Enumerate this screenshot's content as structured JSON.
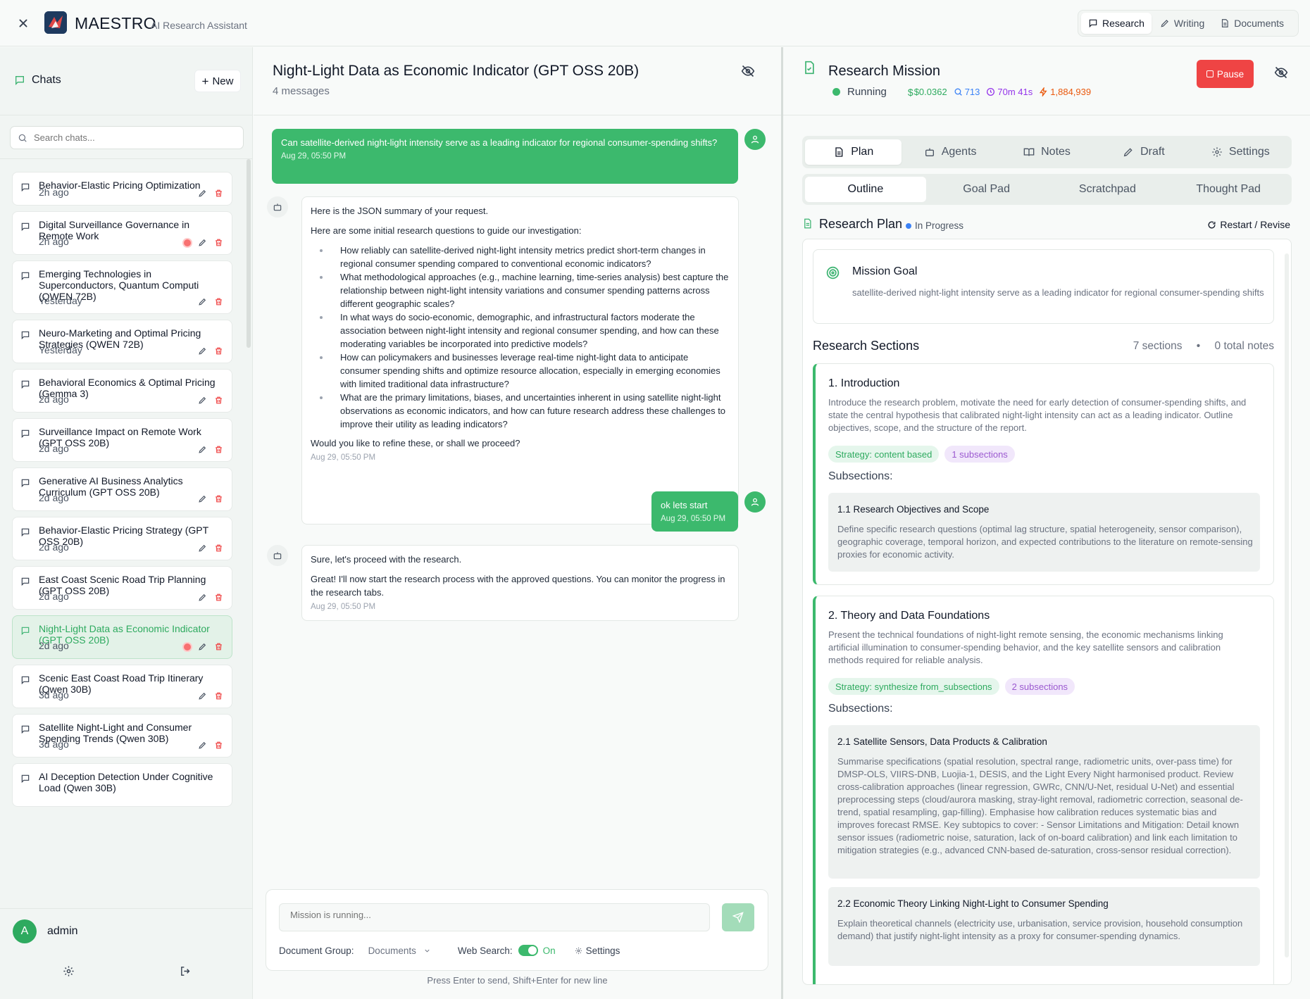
{
  "topbar": {
    "brand": "MAESTRO",
    "brand_sub": "AI Research Assistant",
    "modes": [
      {
        "label": "Research",
        "icon": "chat-bubble-icon",
        "active": true
      },
      {
        "label": "Writing",
        "icon": "pen-icon",
        "active": false
      },
      {
        "label": "Documents",
        "icon": "document-icon",
        "active": false
      }
    ]
  },
  "sidebar": {
    "title": "Chats",
    "new_label": "New",
    "search_placeholder": "Search chats...",
    "items": [
      {
        "title": "Behavior-Elastic Pricing Optimization",
        "time": "2h ago",
        "running": false,
        "active": false
      },
      {
        "title": "Digital Surveillance Governance in Remote Work",
        "time": "2h ago",
        "running": true,
        "active": false
      },
      {
        "title": "Emerging Technologies in Superconductors, Quantum Computi (QWEN 72B)",
        "time": "Yesterday",
        "running": false,
        "active": false
      },
      {
        "title": "Neuro-Marketing and Optimal Pricing Strategies (QWEN 72B)",
        "time": "Yesterday",
        "running": false,
        "active": false
      },
      {
        "title": "Behavioral Economics & Optimal Pricing (Gemma 3)",
        "time": "2d ago",
        "running": false,
        "active": false
      },
      {
        "title": "Surveillance Impact on Remote Work (GPT OSS 20B)",
        "time": "2d ago",
        "running": false,
        "active": false
      },
      {
        "title": "Generative AI Business Analytics Curriculum (GPT OSS 20B)",
        "time": "2d ago",
        "running": false,
        "active": false
      },
      {
        "title": "Behavior-Elastic Pricing Strategy (GPT OSS 20B)",
        "time": "2d ago",
        "running": false,
        "active": false
      },
      {
        "title": "East Coast Scenic Road Trip Planning (GPT OSS 20B)",
        "time": "2d ago",
        "running": false,
        "active": false
      },
      {
        "title": "Night-Light Data as Economic Indicator (GPT OSS 20B)",
        "time": "2d ago",
        "running": true,
        "active": true
      },
      {
        "title": "Scenic East Coast Road Trip Itinerary (Qwen 30B)",
        "time": "3d ago",
        "running": false,
        "active": false
      },
      {
        "title": "Satellite Night-Light and Consumer Spending Trends (Qwen 30B)",
        "time": "3d ago",
        "running": false,
        "active": false
      },
      {
        "title": "AI Deception Detection Under Cognitive Load (Qwen 30B)",
        "time": "",
        "running": false,
        "active": false
      }
    ],
    "user": {
      "initial": "A",
      "name": "admin"
    }
  },
  "chat": {
    "title": "Night-Light Data as Economic Indicator (GPT OSS 20B)",
    "subtitle": "4 messages",
    "messages": [
      {
        "role": "user",
        "text": "Can satellite-derived night-light intensity serve as a leading indicator for regional consumer-spending shifts?",
        "time": "Aug 29, 05:50 PM"
      },
      {
        "role": "assistant",
        "intro": "Here is the JSON summary of your request.",
        "lead": "Here are some initial research questions to guide our investigation:",
        "questions": [
          "How reliably can satellite-derived night-light intensity metrics predict short-term changes in regional consumer spending compared to conventional economic indicators?",
          "What methodological approaches (e.g., machine learning, time-series analysis) best capture the relationship between night-light intensity variations and consumer spending patterns across different geographic scales?",
          "In what ways do socio-economic, demographic, and infrastructural factors moderate the association between night-light intensity and regional consumer spending, and how can these moderating variables be incorporated into predictive models?",
          "How can policymakers and businesses leverage real-time night-light data to anticipate consumer spending shifts and optimize resource allocation, especially in emerging economies with limited traditional data infrastructure?",
          "What are the primary limitations, biases, and uncertainties inherent in using satellite night-light observations as economic indicators, and how can future research address these challenges to improve their utility as leading indicators?"
        ],
        "outro": "Would you like to refine these, or shall we proceed?",
        "time": "Aug 29, 05:50 PM"
      },
      {
        "role": "user",
        "text": "ok lets start",
        "time": "Aug 29, 05:50 PM"
      },
      {
        "role": "assistant",
        "p1": "Sure, let's proceed with the research.",
        "p2": "Great! I'll now start the research process with the approved questions. You can monitor the progress in the research tabs.",
        "time": "Aug 29, 05:50 PM"
      }
    ],
    "composer": {
      "placeholder": "Mission is running...",
      "doc_group_label": "Document Group:",
      "doc_group_value": "Documents",
      "web_search_label": "Web Search:",
      "web_search_value": "On",
      "settings_label": "Settings"
    },
    "hint": "Press Enter to send, Shift+Enter for new line"
  },
  "mission": {
    "title": "Research Mission",
    "status": "Running",
    "cost": "$0.0362",
    "searches": "713",
    "duration": "70m 41s",
    "tokens": "1,884,939",
    "pause_label": "Pause",
    "tabs": [
      {
        "label": "Plan",
        "icon": "document-icon",
        "active": true
      },
      {
        "label": "Agents",
        "icon": "bot-icon",
        "active": false
      },
      {
        "label": "Notes",
        "icon": "book-icon",
        "active": false
      },
      {
        "label": "Draft",
        "icon": "pen-icon",
        "active": false
      },
      {
        "label": "Settings",
        "icon": "gear-icon",
        "active": false
      }
    ],
    "subtabs": [
      {
        "label": "Outline",
        "active": true
      },
      {
        "label": "Goal Pad",
        "active": false
      },
      {
        "label": "Scratchpad",
        "active": false
      },
      {
        "label": "Thought Pad",
        "active": false
      }
    ],
    "plan": {
      "title": "Research Plan",
      "status": "In Progress",
      "restart_label": "Restart / Revise",
      "goal_title": "Mission Goal",
      "goal_text": "satellite-derived night-light intensity serve as a leading indicator for regional consumer-spending shifts",
      "sections_title": "Research Sections",
      "sections_count": "7 sections",
      "notes_count": "0 total notes",
      "subsections_label": "Subsections:",
      "sections": [
        {
          "title": "1. Introduction",
          "desc": "Introduce the research problem, motivate the need for early detection of consumer-spending shifts, and state the central hypothesis that calibrated night-light intensity can act as a leading indicator. Outline objectives, scope, and the structure of the report.",
          "strategy": "Strategy: content based",
          "subcount": "1 subsections",
          "subsections": [
            {
              "title": "1.1 Research Objectives and Scope",
              "text": "Define specific research questions (optimal lag structure, spatial heterogeneity, sensor comparison), geographic coverage, temporal horizon, and expected contributions to the literature on remote-sensing proxies for economic activity."
            }
          ]
        },
        {
          "title": "2. Theory and Data Foundations",
          "desc": "Present the technical foundations of night-light remote sensing, the economic mechanisms linking artificial illumination to consumer-spending behavior, and the key satellite sensors and calibration methods required for reliable analysis.",
          "strategy": "Strategy: synthesize from_subsections",
          "subcount": "2 subsections",
          "subsections": [
            {
              "title": "2.1 Satellite Sensors, Data Products & Calibration",
              "text": "Summarise specifications (spatial resolution, spectral range, radiometric units, over-pass time) for DMSP-OLS, VIIRS-DNB, Luojia-1, DESIS, and the Light Every Night harmonised product. Review cross-calibration approaches (linear regression, GWRc, CNN/U-Net, residual U-Net) and essential preprocessing steps (cloud/aurora masking, stray-light removal, radiometric correction, seasonal de-trend, spatial resampling, gap-filling). Emphasise how calibration reduces systematic bias and improves forecast RMSE. Key subtopics to cover: - Sensor Limitations and Mitigation: Detail known sensor issues (radiometric noise, saturation, lack of on-board calibration) and link each limitation to mitigation strategies (e.g., advanced CNN-based de-saturation, cross-sensor residual correction)."
            },
            {
              "title": "2.2 Economic Theory Linking Night-Light to Consumer Spending",
              "text": "Explain theoretical channels (electricity use, urbanisation, service provision, household consumption demand) that justify night-light intensity as a proxy for consumer-spending dynamics."
            }
          ]
        }
      ]
    }
  }
}
